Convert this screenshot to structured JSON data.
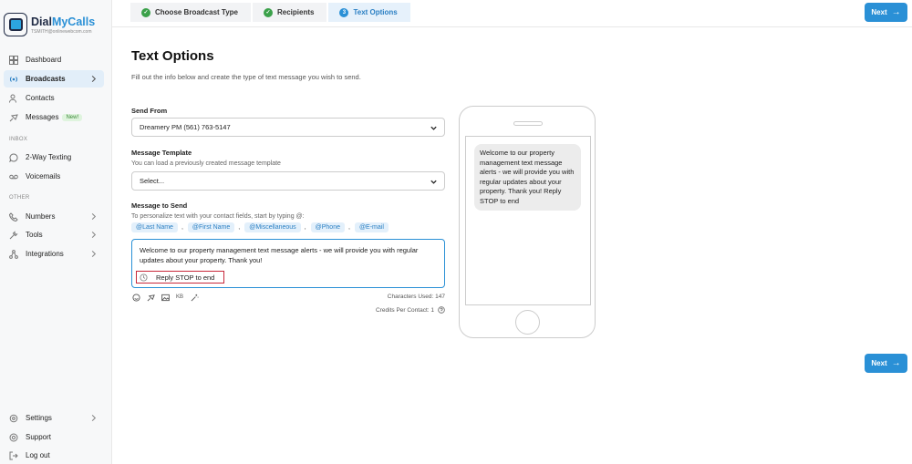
{
  "brand": {
    "name_a": "Dial",
    "name_b": "MyCalls",
    "email": "TSMITH@onlinewebcom.com"
  },
  "sidebar": {
    "items": [
      {
        "label": "Dashboard",
        "icon": "dashboard-icon"
      },
      {
        "label": "Broadcasts",
        "icon": "broadcast-icon"
      },
      {
        "label": "Contacts",
        "icon": "contacts-icon"
      },
      {
        "label": "Messages",
        "icon": "messages-icon",
        "badge": "New!"
      }
    ],
    "inbox_label": "INBOX",
    "inbox_items": [
      {
        "label": "2-Way Texting",
        "icon": "chat-icon"
      },
      {
        "label": "Voicemails",
        "icon": "voicemail-icon"
      }
    ],
    "other_label": "OTHER",
    "other_items": [
      {
        "label": "Numbers",
        "icon": "phone-icon"
      },
      {
        "label": "Tools",
        "icon": "tools-icon"
      },
      {
        "label": "Integrations",
        "icon": "integrations-icon"
      }
    ],
    "bottom_items": [
      {
        "label": "Settings",
        "icon": "gear-icon"
      },
      {
        "label": "Support",
        "icon": "support-icon"
      },
      {
        "label": "Log out",
        "icon": "logout-icon"
      }
    ]
  },
  "steps": [
    {
      "label": "Choose Broadcast Type",
      "status": "done"
    },
    {
      "label": "Recipients",
      "status": "done"
    },
    {
      "label": "Text Options",
      "status": "current",
      "num": "3"
    }
  ],
  "next_label": "Next",
  "page": {
    "title": "Text Options",
    "subtitle": "Fill out the info below and create the type of text message you wish to send."
  },
  "send_from": {
    "label": "Send From",
    "value": "Dreamery PM (561) 763-5147"
  },
  "template": {
    "label": "Message Template",
    "hint": "You can load a previously created message template",
    "value": "Select..."
  },
  "message": {
    "label": "Message to Send",
    "hint": "To personalize text with your contact fields, start by typing @:",
    "tags": [
      "@Last Name",
      "@First Name",
      "@Miscellaneous",
      "@Phone",
      "@E-mail"
    ],
    "body": "Welcome to our property management text message alerts - we will provide you with regular updates about your property. Thank you!",
    "stop_text": "Reply STOP to end",
    "chars_used": "Characters Used: 147",
    "credits": "Credits Per Contact: 1"
  },
  "preview": {
    "bubble": "Welcome to our property management text message alerts - we will provide you with regular updates about your property. Thank you! Reply STOP to end"
  },
  "colors": {
    "accent": "#2a90d6",
    "done": "#3ba14a",
    "stop_border": "#c7283a"
  }
}
